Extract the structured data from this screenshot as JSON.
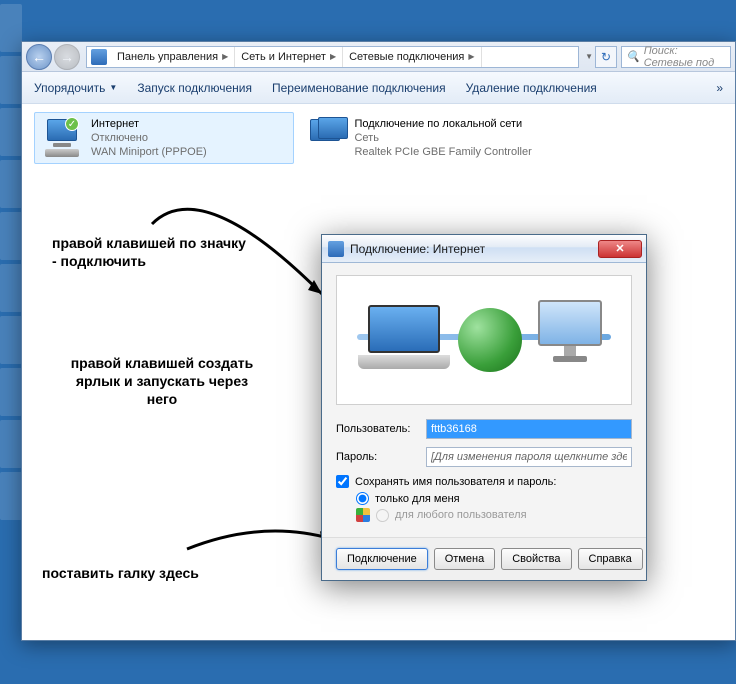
{
  "nav": {
    "crumbs": [
      "Панель управления",
      "Сеть и Интернет",
      "Сетевые подключения"
    ],
    "search_placeholder": "Поиск: Сетевые под"
  },
  "toolbar": {
    "organize": "Упорядочить",
    "start": "Запуск подключения",
    "rename": "Переименование подключения",
    "delete": "Удаление подключения",
    "more": "»"
  },
  "connections": [
    {
      "title": "Интернет",
      "status": "Отключено",
      "device": "WAN Miniport (PPPOE)"
    },
    {
      "title": "Подключение по локальной сети",
      "status": "Сеть",
      "device": "Realtek PCIe GBE Family Controller"
    }
  ],
  "annot": {
    "a1": "правой клавишей по значку - подключить",
    "a2": "правой клавишей создать ярлык и запускать через него",
    "a3": "поставить галку здесь"
  },
  "dialog": {
    "title": "Подключение: Интернет",
    "user_label": "Пользователь:",
    "user_value": "fttb36168",
    "pass_label": "Пароль:",
    "pass_placeholder": "[Для изменения пароля щелкните здесь]",
    "save_label": "Сохранять имя пользователя и пароль:",
    "only_me": "только для меня",
    "any_user": "для любого пользователя",
    "btn_connect": "Подключение",
    "btn_cancel": "Отмена",
    "btn_props": "Свойства",
    "btn_help": "Справка"
  }
}
